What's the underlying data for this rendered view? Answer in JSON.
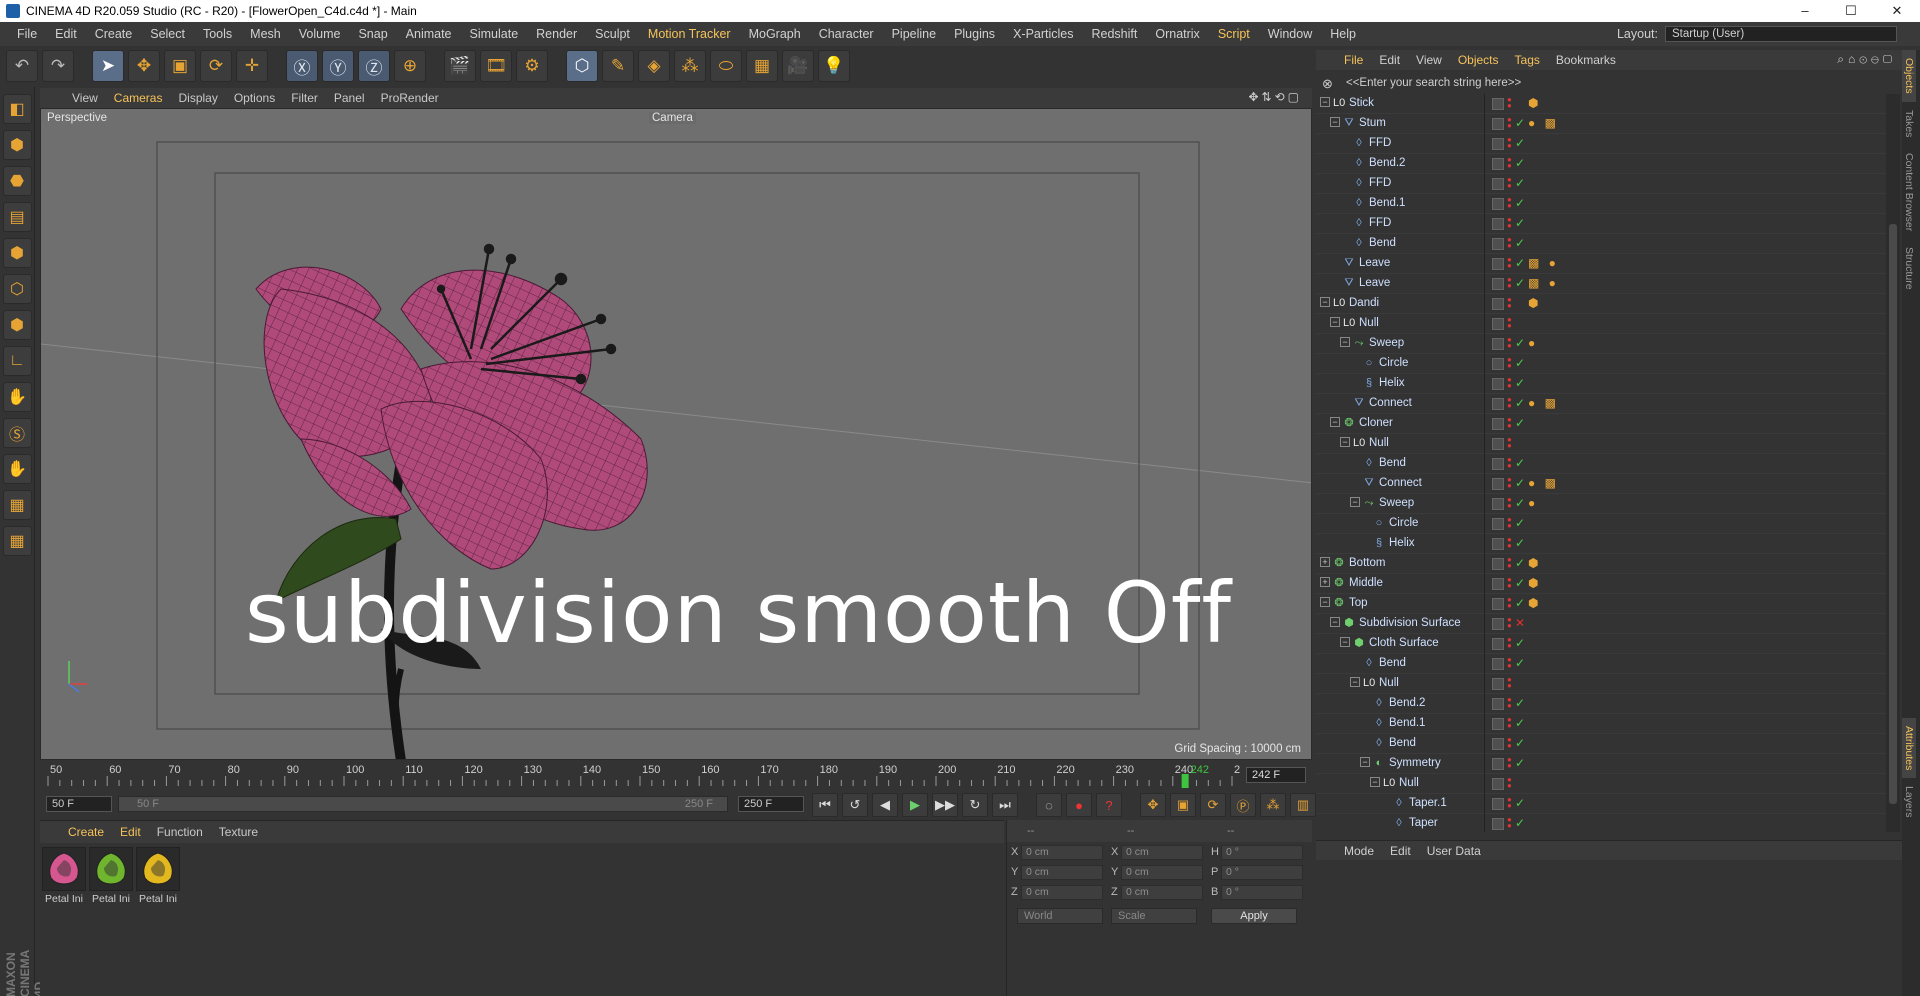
{
  "window": {
    "title": "CINEMA 4D R20.059 Studio (RC - R20) - [FlowerOpen_C4d.c4d *] - Main",
    "controls": [
      "–",
      "☐",
      "✕"
    ]
  },
  "menubar": {
    "items": [
      "File",
      "Edit",
      "Create",
      "Select",
      "Tools",
      "Mesh",
      "Volume",
      "Snap",
      "Animate",
      "Simulate",
      "Render",
      "Sculpt",
      "Motion Tracker",
      "MoGraph",
      "Character",
      "Pipeline",
      "Plugins",
      "X-Particles",
      "Redshift",
      "Ornatrix",
      "Script",
      "Window",
      "Help"
    ],
    "highlighted": [
      "Motion Tracker",
      "Script"
    ],
    "layout_label": "Layout:",
    "layout_value": "Startup (User)"
  },
  "toolbar": {
    "icons": [
      "undo-icon",
      "redo-icon",
      "select-arrow-icon",
      "move-icon",
      "scale-icon",
      "rotate-icon",
      "live-select-icon",
      "x-axis-icon",
      "y-axis-icon",
      "z-axis-icon",
      "coord-system-icon",
      "render-view-icon",
      "render-picture-viewer-icon",
      "render-settings-icon",
      "cube-icon",
      "pen-icon",
      "subdivision-icon",
      "cloner-icon",
      "deformer-icon",
      "floor-icon",
      "camera-icon",
      "light-icon"
    ],
    "glyphs": [
      "↶",
      "↷",
      "➤",
      "✥",
      "▣",
      "⟳",
      "✛",
      "Ⓧ",
      "Ⓨ",
      "Ⓩ",
      "⊕",
      "🎬",
      "🎞",
      "⚙",
      "⬡",
      "✎",
      "◈",
      "⁂",
      "⬭",
      "▦",
      "🎥",
      "💡"
    ]
  },
  "lefttools": {
    "glyphs": [
      "◧",
      "⬢",
      "⬣",
      "▤",
      "⬢",
      "⬡",
      "⬢",
      "∟",
      "✋",
      "Ⓢ",
      "✋",
      "▦",
      "▦"
    ]
  },
  "viewport": {
    "menu": [
      "View",
      "Cameras",
      "Display",
      "Options",
      "Filter",
      "Panel",
      "ProRender"
    ],
    "menu_highlight": "Cameras",
    "view_name": "Perspective",
    "camera_label": "Camera",
    "grid_spacing": "Grid Spacing : 10000 cm",
    "overlay_text": "subdivision smooth Off"
  },
  "timeline": {
    "labels": [
      "50",
      "60",
      "70",
      "80",
      "90",
      "100",
      "110",
      "120",
      "130",
      "140",
      "150",
      "160",
      "170",
      "180",
      "190",
      "200",
      "210",
      "220",
      "230",
      "240",
      "250"
    ],
    "current_frame": "242",
    "frame_field": "242 F"
  },
  "transport": {
    "start_field": "50 F",
    "range_start": "50 F",
    "range_end": "250 F",
    "end_field": "250 F",
    "buttons": [
      "⏮",
      "↺",
      "◀",
      "▶",
      "▶▶",
      "↻",
      "⏭",
      "◌",
      "●",
      "?",
      "✥",
      "▣",
      "⟳",
      "Ⓟ",
      "⁂",
      "▥"
    ]
  },
  "materials": {
    "menu": [
      "Create",
      "Edit",
      "Function",
      "Texture"
    ],
    "menu_highlight": [
      "Create",
      "Edit"
    ],
    "items": [
      {
        "name": "Petal Ini",
        "color": "#d6568f"
      },
      {
        "name": "Petal Ini",
        "color": "#6fb52d"
      },
      {
        "name": "Petal Ini",
        "color": "#e3b81f"
      }
    ]
  },
  "coordinates": {
    "headers": [
      "--",
      "--",
      "--"
    ],
    "rows": [
      {
        "a": "X",
        "av": "0 cm",
        "b": "X",
        "bv": "0 cm",
        "c": "H",
        "cv": "0 °"
      },
      {
        "a": "Y",
        "av": "0 cm",
        "b": "Y",
        "bv": "0 cm",
        "c": "P",
        "cv": "0 °"
      },
      {
        "a": "Z",
        "av": "0 cm",
        "b": "Z",
        "bv": "0 cm",
        "c": "B",
        "cv": "0 °"
      }
    ],
    "mode1": "World",
    "mode2": "Scale",
    "apply": "Apply"
  },
  "object_manager": {
    "menu": [
      "File",
      "Edit",
      "View",
      "Objects",
      "Tags",
      "Bookmarks"
    ],
    "menu_highlight": [
      "File",
      "Objects",
      "Tags"
    ],
    "search_placeholder": "<<Enter your search string here>>",
    "rows": [
      {
        "name": "Stick",
        "level": 1,
        "exp": "−",
        "icon": "null",
        "chk": "",
        "tags": "⬢"
      },
      {
        "name": "Stum",
        "level": 2,
        "exp": "−",
        "icon": "connect",
        "chk": "✓",
        "tags": "● ▩"
      },
      {
        "name": "FFD",
        "level": 3,
        "exp": "",
        "icon": "deform",
        "chk": "✓",
        "tags": ""
      },
      {
        "name": "Bend.2",
        "level": 3,
        "exp": "",
        "icon": "deform",
        "chk": "✓",
        "tags": ""
      },
      {
        "name": "FFD",
        "level": 3,
        "exp": "",
        "icon": "deform",
        "chk": "✓",
        "tags": ""
      },
      {
        "name": "Bend.1",
        "level": 3,
        "exp": "",
        "icon": "deform",
        "chk": "✓",
        "tags": ""
      },
      {
        "name": "FFD",
        "level": 3,
        "exp": "",
        "icon": "deform",
        "chk": "✓",
        "tags": ""
      },
      {
        "name": "Bend",
        "level": 3,
        "exp": "",
        "icon": "deform",
        "chk": "✓",
        "tags": ""
      },
      {
        "name": "Leave",
        "level": 2,
        "exp": "",
        "icon": "connect",
        "chk": "✓",
        "tags": "▩ ●"
      },
      {
        "name": "Leave",
        "level": 2,
        "exp": "",
        "icon": "connect",
        "chk": "✓",
        "tags": "▩ ●"
      },
      {
        "name": "Dandi",
        "level": 1,
        "exp": "−",
        "icon": "null",
        "chk": "",
        "tags": "⬢"
      },
      {
        "name": "Null",
        "level": 2,
        "exp": "−",
        "icon": "null",
        "chk": "",
        "tags": ""
      },
      {
        "name": "Sweep",
        "level": 3,
        "exp": "−",
        "icon": "sweep",
        "chk": "✓",
        "tags": "●"
      },
      {
        "name": "Circle",
        "level": 4,
        "exp": "",
        "icon": "circle",
        "chk": "✓",
        "tags": ""
      },
      {
        "name": "Helix",
        "level": 4,
        "exp": "",
        "icon": "helix",
        "chk": "✓",
        "tags": ""
      },
      {
        "name": "Connect",
        "level": 3,
        "exp": "",
        "icon": "connect",
        "chk": "✓",
        "tags": "● ▩"
      },
      {
        "name": "Cloner",
        "level": 2,
        "exp": "−",
        "icon": "cloner",
        "chk": "✓",
        "tags": ""
      },
      {
        "name": "Null",
        "level": 3,
        "exp": "−",
        "icon": "null",
        "chk": "",
        "tags": ""
      },
      {
        "name": "Bend",
        "level": 4,
        "exp": "",
        "icon": "deform",
        "chk": "✓",
        "tags": ""
      },
      {
        "name": "Connect",
        "level": 4,
        "exp": "",
        "icon": "connect",
        "chk": "✓",
        "tags": "● ▩"
      },
      {
        "name": "Sweep",
        "level": 4,
        "exp": "−",
        "icon": "sweep",
        "chk": "✓",
        "tags": "●"
      },
      {
        "name": "Circle",
        "level": 5,
        "exp": "",
        "icon": "circle",
        "chk": "✓",
        "tags": ""
      },
      {
        "name": "Helix",
        "level": 5,
        "exp": "",
        "icon": "helix",
        "chk": "✓",
        "tags": ""
      },
      {
        "name": "Bottom",
        "level": 1,
        "exp": "+",
        "icon": "cloner",
        "chk": "✓",
        "tags": "⬢"
      },
      {
        "name": "Middle",
        "level": 1,
        "exp": "+",
        "icon": "cloner",
        "chk": "✓",
        "tags": "⬢"
      },
      {
        "name": "Top",
        "level": 1,
        "exp": "−",
        "icon": "cloner",
        "chk": "✓",
        "tags": "⬢"
      },
      {
        "name": "Subdivision Surface",
        "level": 2,
        "exp": "−",
        "icon": "subdiv",
        "chk": "✕",
        "tags": ""
      },
      {
        "name": "Cloth Surface",
        "level": 3,
        "exp": "−",
        "icon": "cloth",
        "chk": "✓",
        "tags": ""
      },
      {
        "name": "Bend",
        "level": 4,
        "exp": "",
        "icon": "deform",
        "chk": "✓",
        "tags": ""
      },
      {
        "name": "Null",
        "level": 4,
        "exp": "−",
        "icon": "null",
        "chk": "",
        "tags": ""
      },
      {
        "name": "Bend.2",
        "level": 5,
        "exp": "",
        "icon": "deform",
        "chk": "✓",
        "tags": ""
      },
      {
        "name": "Bend.1",
        "level": 5,
        "exp": "",
        "icon": "deform",
        "chk": "✓",
        "tags": ""
      },
      {
        "name": "Bend",
        "level": 5,
        "exp": "",
        "icon": "deform",
        "chk": "✓",
        "tags": ""
      },
      {
        "name": "Symmetry",
        "level": 5,
        "exp": "−",
        "icon": "symmetry",
        "chk": "✓",
        "tags": ""
      },
      {
        "name": "Null",
        "level": 6,
        "exp": "−",
        "icon": "null",
        "chk": "",
        "tags": ""
      },
      {
        "name": "Taper.1",
        "level": 7,
        "exp": "",
        "icon": "deform",
        "chk": "✓",
        "tags": ""
      },
      {
        "name": "Taper",
        "level": 7,
        "exp": "",
        "icon": "deform",
        "chk": "✓",
        "tags": ""
      }
    ]
  },
  "attributes": {
    "menu": [
      "Mode",
      "Edit",
      "User Data"
    ]
  },
  "side_tabs": [
    "Objects",
    "Takes",
    "Content Browser",
    "Structure",
    "Attributes",
    "Layers"
  ],
  "brand": "MAXON CINEMA 4D",
  "colors": {
    "accent": "#f6c35a",
    "petal": "#b04a7a",
    "leaf": "#3d5a22",
    "viewport_bg": "#6f6f6f",
    "panel_bg": "#333333"
  }
}
